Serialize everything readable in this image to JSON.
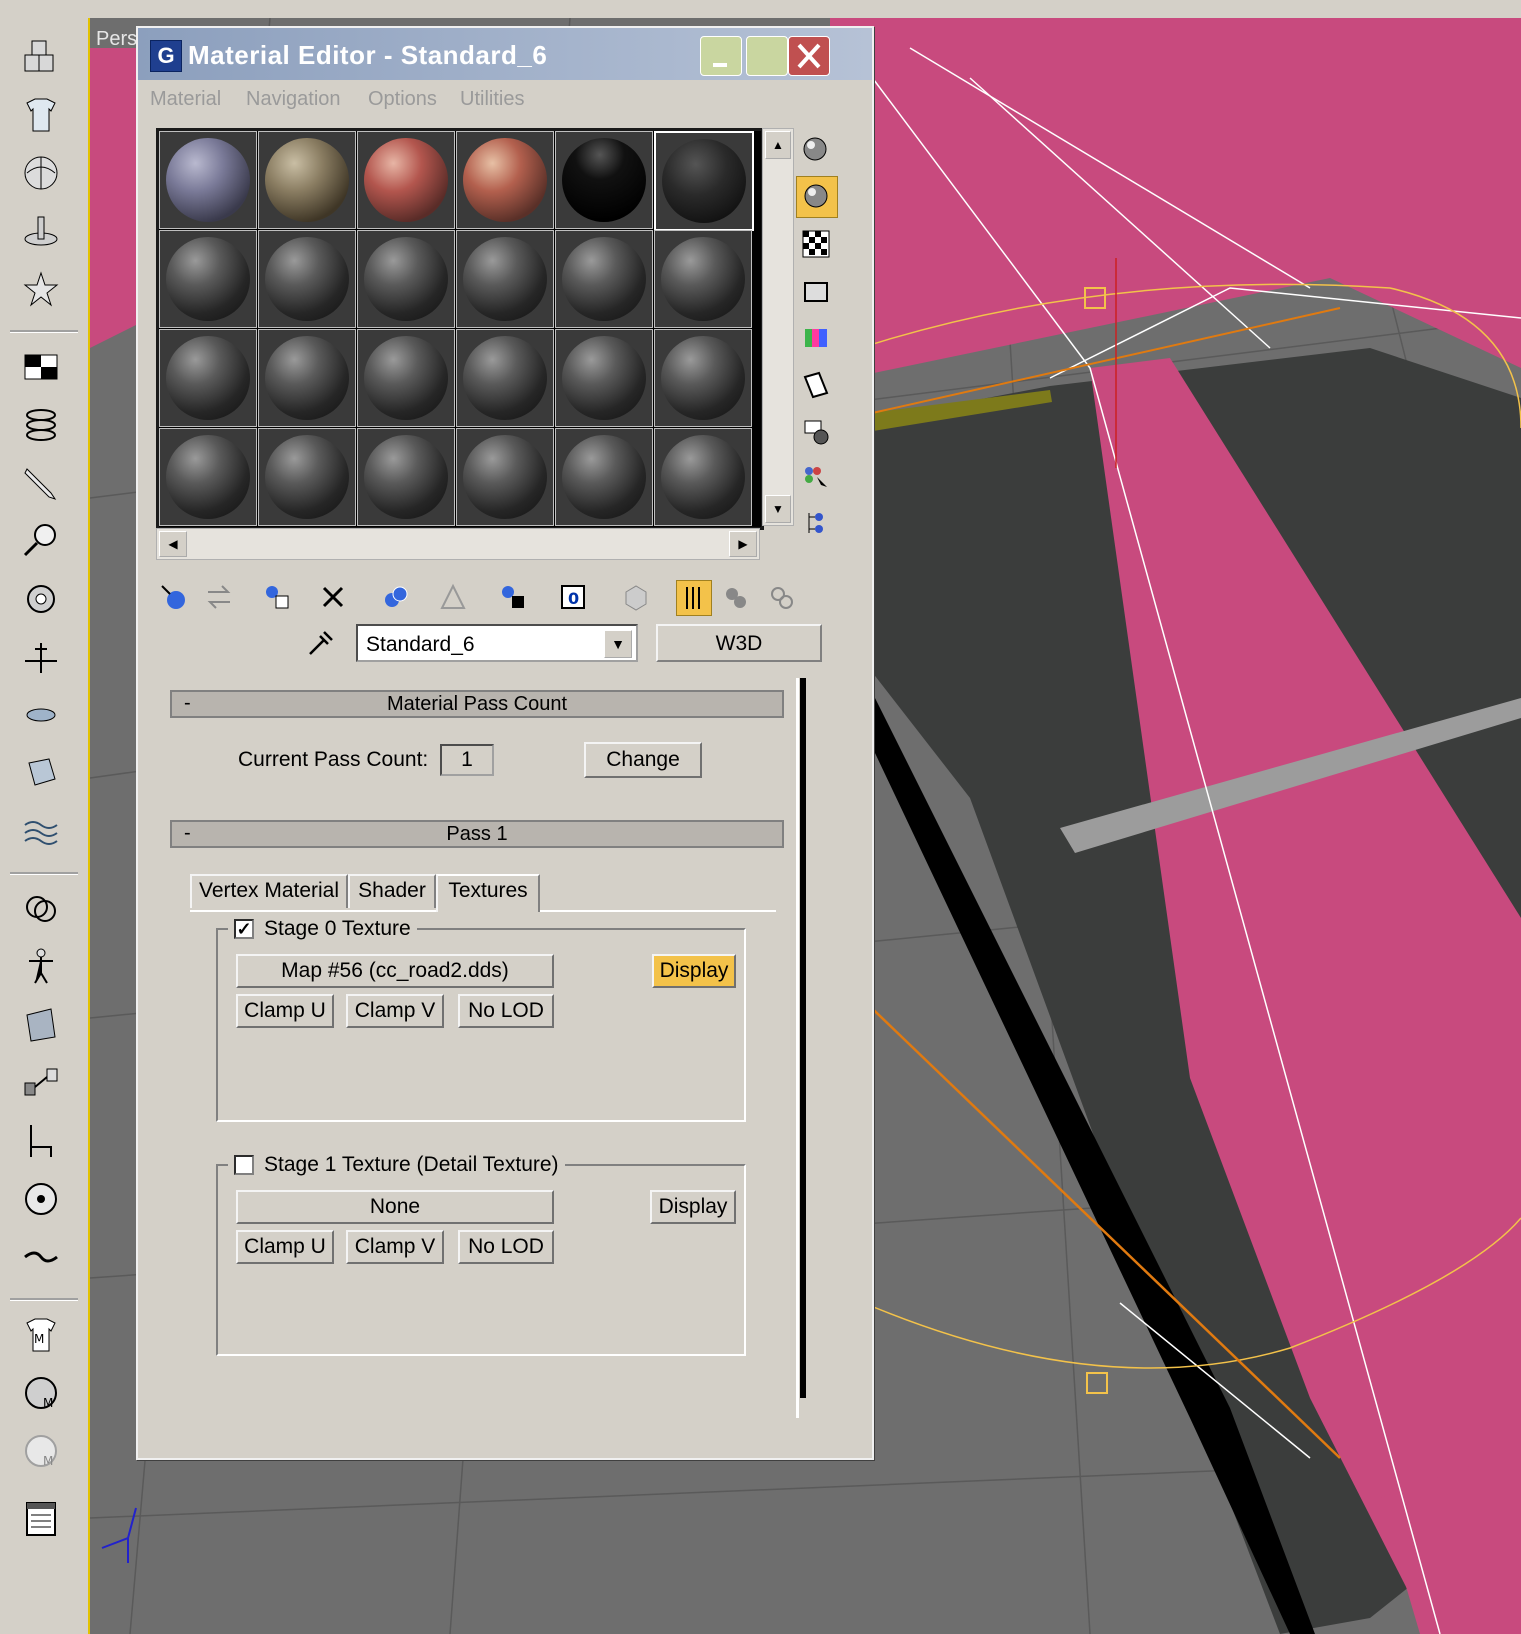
{
  "viewport": {
    "label": "Pers"
  },
  "window": {
    "title": "Material Editor - Standard_6"
  },
  "menu": {
    "items": [
      "Material",
      "Navigation",
      "Options",
      "Utilities"
    ]
  },
  "material_name": "Standard_6",
  "w3d_button": "W3D",
  "pass_count": {
    "header": "Material Pass Count",
    "current_label": "Current Pass Count:",
    "value": "1",
    "change_button": "Change"
  },
  "pass1": {
    "header": "Pass 1",
    "tabs": [
      "Vertex Material",
      "Shader",
      "Textures"
    ],
    "active_tab": "Textures",
    "stage0": {
      "title": "Stage 0 Texture",
      "checked": true,
      "map_button": "Map #56 (cc_road2.dds)",
      "display_button": "Display",
      "clamp_u": "Clamp U",
      "clamp_v": "Clamp V",
      "no_lod": "No LOD"
    },
    "stage1": {
      "title": "Stage 1 Texture (Detail Texture)",
      "checked": false,
      "map_button": "None",
      "display_button": "Display",
      "clamp_u": "Clamp U",
      "clamp_v": "Clamp V",
      "no_lod": "No LOD"
    }
  },
  "colors": {
    "road_pink": "#c84a7e",
    "road_asphalt": "#3b3d3c",
    "selection_yellow": "#f3c24a",
    "toolbar_bg": "#d4d0c8"
  }
}
